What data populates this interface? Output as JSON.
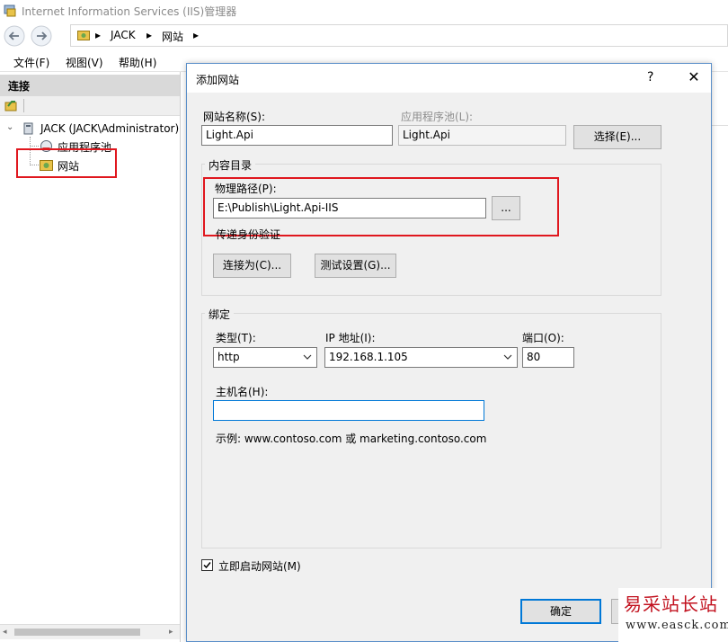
{
  "window": {
    "title": "Internet Information Services (IIS)管理器"
  },
  "nav": {
    "crumbs": [
      "JACK",
      "网站"
    ]
  },
  "menu": {
    "items": [
      "文件(F)",
      "视图(V)",
      "帮助(H)"
    ]
  },
  "connections": {
    "header": "连接",
    "tree": {
      "server": "JACK (JACK\\Administrator)",
      "app_pools": "应用程序池",
      "sites": "网站"
    }
  },
  "dialog": {
    "title": "添加网站",
    "help": "?",
    "close": "✕",
    "site_name_label": "网站名称(S):",
    "site_name_value": "Light.Api",
    "app_pool_label": "应用程序池(L):",
    "app_pool_value": "Light.Api",
    "select_button": "选择(E)...",
    "content_dir": {
      "title": "内容目录",
      "physical_path_label": "物理路径(P):",
      "physical_path_value": "E:\\Publish\\Light.Api-IIS",
      "browse_button": "...",
      "pass_through_label": "传递身份验证",
      "connect_as_button": "连接为(C)...",
      "test_settings_button": "测试设置(G)..."
    },
    "binding": {
      "title": "绑定",
      "type_label": "类型(T):",
      "type_value": "http",
      "ip_label": "IP 地址(I):",
      "ip_value": "192.168.1.105",
      "port_label": "端口(O):",
      "port_value": "80",
      "host_label": "主机名(H):",
      "host_value": "",
      "example": "示例: www.contoso.com 或 marketing.contoso.com"
    },
    "start_immediately_label": "立即启动网站(M)",
    "start_immediately_checked": true,
    "ok_button": "确定"
  },
  "watermark": {
    "cn": "易采站长站",
    "url": "www.easck.com"
  },
  "colors": {
    "highlight_red": "#e0171e",
    "dialog_bg": "#f0f0f0",
    "default_button_border": "#0078d7"
  }
}
